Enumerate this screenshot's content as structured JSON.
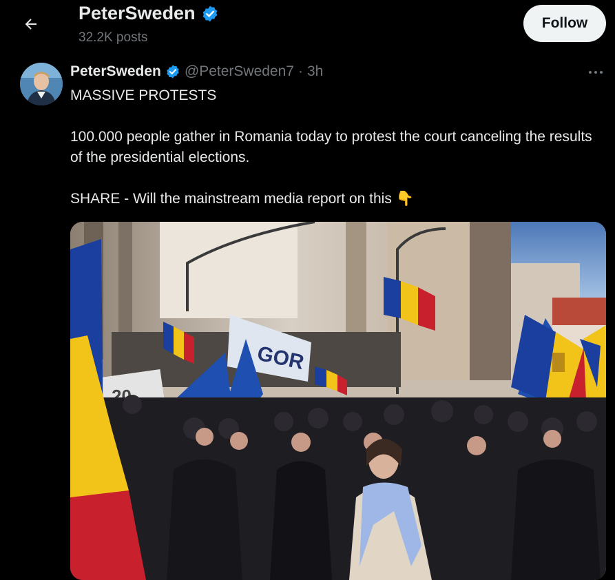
{
  "header": {
    "back_icon": "arrow-left-icon",
    "title": "PeterSweden",
    "post_count": "32.2K posts",
    "follow_label": "Follow",
    "verified_icon": "verified-badge-icon"
  },
  "post": {
    "author_name": "PeterSweden",
    "handle": "@PeterSweden7",
    "separator": "·",
    "time": "3h",
    "more_icon": "more-horizontal-icon",
    "lines": [
      "MASSIVE PROTESTS",
      "100.000 people gather in Romania today to protest the court canceling the results of the presidential elections.",
      "SHARE - Will the mainstream media report on this"
    ],
    "emoji": "👇",
    "media": {
      "banner_text": "GOR",
      "sign_text": "20"
    }
  },
  "colors": {
    "background": "#000000",
    "text": "#e7e9ea",
    "muted": "#71767b",
    "verified": "#1d9bf0",
    "follow_bg": "#eff3f4",
    "flag_blue": "#1b3f9e",
    "flag_yellow": "#f2c318",
    "flag_red": "#c8202c"
  }
}
